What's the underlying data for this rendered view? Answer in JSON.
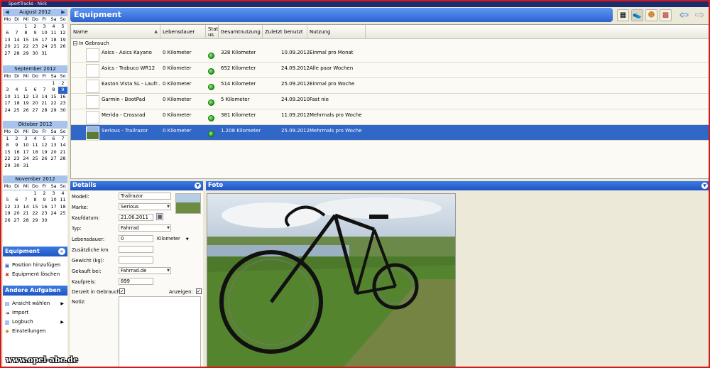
{
  "window": {
    "title": "SportTracks - Nick"
  },
  "calendars": [
    {
      "month": "August 2012",
      "days_header": [
        "Mo",
        "Di",
        "Mi",
        "Do",
        "Fr",
        "Sa",
        "So"
      ],
      "weeks": [
        [
          "",
          "",
          "1",
          "2",
          "3",
          "4",
          "5"
        ],
        [
          "6",
          "7",
          "8",
          "9",
          "10",
          "11",
          "12"
        ],
        [
          "13",
          "14",
          "15",
          "16",
          "17",
          "18",
          "19"
        ],
        [
          "20",
          "21",
          "22",
          "23",
          "24",
          "25",
          "26"
        ],
        [
          "27",
          "28",
          "29",
          "30",
          "31",
          "",
          ""
        ]
      ]
    },
    {
      "month": "September 2012",
      "days_header": [
        "Mo",
        "Di",
        "Mi",
        "Do",
        "Fr",
        "Sa",
        "So"
      ],
      "weeks": [
        [
          "",
          "",
          "",
          "",
          "",
          "1",
          "2"
        ],
        [
          "3",
          "4",
          "5",
          "6",
          "7",
          "8",
          "9"
        ],
        [
          "10",
          "11",
          "12",
          "13",
          "14",
          "15",
          "16"
        ],
        [
          "17",
          "18",
          "19",
          "20",
          "21",
          "22",
          "23"
        ],
        [
          "24",
          "25",
          "26",
          "27",
          "28",
          "29",
          "30"
        ]
      ],
      "selected": "9"
    },
    {
      "month": "Oktober 2012",
      "days_header": [
        "Mo",
        "Di",
        "Mi",
        "Do",
        "Fr",
        "Sa",
        "So"
      ],
      "weeks": [
        [
          "1",
          "2",
          "3",
          "4",
          "5",
          "6",
          "7"
        ],
        [
          "8",
          "9",
          "10",
          "11",
          "12",
          "13",
          "14"
        ],
        [
          "15",
          "16",
          "17",
          "18",
          "19",
          "20",
          "21"
        ],
        [
          "22",
          "23",
          "24",
          "25",
          "26",
          "27",
          "28"
        ],
        [
          "29",
          "30",
          "31",
          "",
          "",
          "",
          ""
        ]
      ]
    },
    {
      "month": "November 2012",
      "days_header": [
        "Mo",
        "Di",
        "Mi",
        "Do",
        "Fr",
        "Sa",
        "So"
      ],
      "weeks": [
        [
          "",
          "",
          "",
          "1",
          "2",
          "3",
          "4"
        ],
        [
          "5",
          "6",
          "7",
          "8",
          "9",
          "10",
          "11"
        ],
        [
          "12",
          "13",
          "14",
          "15",
          "16",
          "17",
          "18"
        ],
        [
          "19",
          "20",
          "21",
          "22",
          "23",
          "24",
          "25"
        ],
        [
          "26",
          "27",
          "28",
          "29",
          "30",
          "",
          ""
        ]
      ]
    }
  ],
  "sidebar": {
    "equipment_title": "Equipment",
    "equipment_tasks": [
      {
        "label": "Position hinzufügen",
        "icon": "add-icon"
      },
      {
        "label": "Equipment löschen",
        "icon": "delete-icon"
      }
    ],
    "other_title": "Andere Aufgaben",
    "other_tasks": [
      {
        "label": "Ansicht wählen",
        "icon": "view-icon",
        "submenu": true
      },
      {
        "label": "Import",
        "icon": "import-icon",
        "submenu": false
      },
      {
        "label": "Logbuch",
        "icon": "logbook-icon",
        "submenu": true
      },
      {
        "label": "Einstellungen",
        "icon": "settings-icon",
        "submenu": false
      }
    ]
  },
  "main": {
    "title": "Equipment",
    "toolbar": [
      "table-view-icon",
      "shoe-icon",
      "person-icon",
      "calendar-icon",
      "back-arrow-icon",
      "forward-arrow-icon"
    ],
    "columns": [
      "Name",
      "Lebensdauer",
      "Stat us",
      "Gesamtnutzung",
      "Zuletzt benutzt",
      "Nutzung"
    ],
    "group": "In Gebrauch",
    "rows": [
      {
        "name": "Asics - Asics Kayano",
        "lebensdauer": "0 Kilometer",
        "gesamt": "328 Kilometer",
        "zuletzt": "10.09.2012",
        "nutzung": "Einmal pro Monat"
      },
      {
        "name": "Asics - Trabuco WR12",
        "lebensdauer": "0 Kilometer",
        "gesamt": "652 Kilometer",
        "zuletzt": "24.09.2012",
        "nutzung": "Alle paar Wochen"
      },
      {
        "name": "Easton Vista SL - Laufr...",
        "lebensdauer": "0 Kilometer",
        "gesamt": "514 Kilometer",
        "zuletzt": "25.09.2012",
        "nutzung": "Einmal pro Woche"
      },
      {
        "name": "Garmin - BootPad",
        "lebensdauer": "0 Kilometer",
        "gesamt": "5 Kilometer",
        "zuletzt": "24.09.2010",
        "nutzung": "Fast nie"
      },
      {
        "name": "Merida - Crossrad",
        "lebensdauer": "0 Kilometer",
        "gesamt": "381 Kilometer",
        "zuletzt": "11.09.2012",
        "nutzung": "Mehrmals pro Woche"
      },
      {
        "name": "Serious - Trailrazor",
        "lebensdauer": "0 Kilometer",
        "gesamt": "1.208 Kilometer",
        "zuletzt": "25.09.2012",
        "nutzung": "Mehrmals pro Woche"
      }
    ],
    "selected_row": 5
  },
  "details": {
    "title": "Details",
    "modell_label": "Modell:",
    "modell": "Trailrazor",
    "marke_label": "Marke:",
    "marke": "Serious",
    "kaufdatum_label": "Kaufdatum:",
    "kaufdatum": "21.06.2011",
    "typ_label": "Typ:",
    "typ": "Fahrrad",
    "lebensdauer_label": "Lebensdauer:",
    "lebensdauer": "0",
    "lebensdauer_unit": "Kilometer",
    "zusatz_label": "Zusätzliche km",
    "zusatz": "",
    "gewicht_label": "Gewicht (kg):",
    "gewicht": "",
    "gekauft_label": "Gekauft bei:",
    "gekauft": "Fahrrad.de",
    "kaufpreis_label": "Kaufpreis:",
    "kaufpreis": "899",
    "gebrauch_label": "Derzeit in Gebrauch:",
    "gebrauch_checked": true,
    "anzeigen_label": "Anzeigen:",
    "anzeigen_checked": true,
    "notiz_label": "Notiz:"
  },
  "foto": {
    "title": "Foto"
  },
  "watermark": "www.opel-abc.de",
  "colors": {
    "accent": "#2c63d0",
    "selection": "#3167c6",
    "frame": "#d21a1a",
    "status_ok": "#1f9a16"
  }
}
